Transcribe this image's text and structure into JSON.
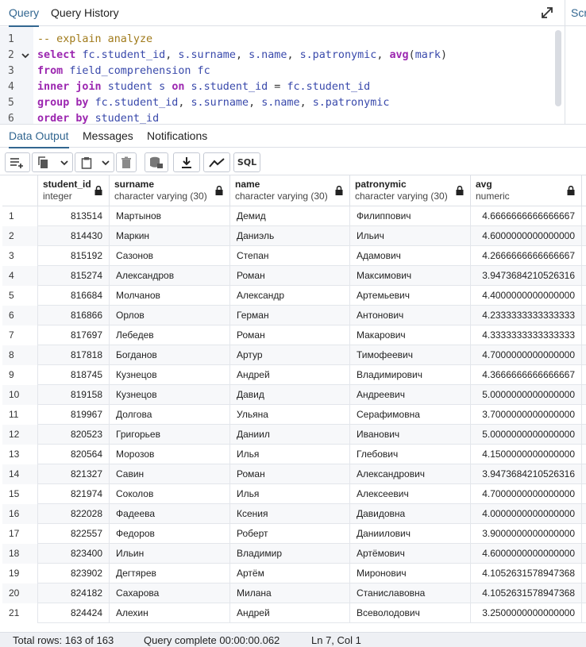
{
  "top_tabs": [
    {
      "label": "Query",
      "active": true
    },
    {
      "label": "Query History",
      "active": false
    }
  ],
  "side_tab_label": "Scr",
  "editor": {
    "lines": [
      {
        "n": "1",
        "tokens": [
          [
            "cm",
            "-- explain analyze"
          ]
        ]
      },
      {
        "n": "2",
        "fold": true,
        "tokens": [
          [
            "kw",
            "select"
          ],
          [
            "op",
            " "
          ],
          [
            "id",
            "fc.student_id"
          ],
          [
            "op",
            ", "
          ],
          [
            "id",
            "s.surname"
          ],
          [
            "op",
            ", "
          ],
          [
            "id",
            "s.name"
          ],
          [
            "op",
            ", "
          ],
          [
            "id",
            "s.patronymic"
          ],
          [
            "op",
            ", "
          ],
          [
            "kw",
            "avg"
          ],
          [
            "op",
            "("
          ],
          [
            "id",
            "mark"
          ],
          [
            "op",
            ")"
          ]
        ]
      },
      {
        "n": "3",
        "tokens": [
          [
            "kw",
            "from"
          ],
          [
            "op",
            " "
          ],
          [
            "id",
            "field_comprehension fc"
          ]
        ]
      },
      {
        "n": "4",
        "tokens": [
          [
            "kw",
            "inner join"
          ],
          [
            "op",
            " "
          ],
          [
            "id",
            "student s"
          ],
          [
            "op",
            " "
          ],
          [
            "kw",
            "on"
          ],
          [
            "op",
            " "
          ],
          [
            "id",
            "s.student_id"
          ],
          [
            "op",
            " = "
          ],
          [
            "id",
            "fc.student_id"
          ]
        ]
      },
      {
        "n": "5",
        "tokens": [
          [
            "kw",
            "group by"
          ],
          [
            "op",
            " "
          ],
          [
            "id",
            "fc.student_id"
          ],
          [
            "op",
            ", "
          ],
          [
            "id",
            "s.surname"
          ],
          [
            "op",
            ", "
          ],
          [
            "id",
            "s.name"
          ],
          [
            "op",
            ", "
          ],
          [
            "id",
            "s.patronymic"
          ]
        ]
      },
      {
        "n": "6",
        "tokens": [
          [
            "kw",
            "order by"
          ],
          [
            "op",
            " "
          ],
          [
            "id",
            "student_id"
          ]
        ]
      }
    ]
  },
  "result_tabs": [
    {
      "label": "Data Output",
      "active": true
    },
    {
      "label": "Messages",
      "active": false
    },
    {
      "label": "Notifications",
      "active": false
    }
  ],
  "toolbar": {
    "sql_label": "SQL"
  },
  "columns": [
    {
      "name": "student_id",
      "type": "integer"
    },
    {
      "name": "surname",
      "type": "character varying (30)"
    },
    {
      "name": "name",
      "type": "character varying (30)"
    },
    {
      "name": "patronymic",
      "type": "character varying (30)"
    },
    {
      "name": "avg",
      "type": "numeric"
    }
  ],
  "rows": [
    [
      "1",
      "813514",
      "Мартынов",
      "Демид",
      "Филиппович",
      "4.6666666666666667"
    ],
    [
      "2",
      "814430",
      "Маркин",
      "Даниэль",
      "Ильич",
      "4.6000000000000000"
    ],
    [
      "3",
      "815192",
      "Сазонов",
      "Степан",
      "Адамович",
      "4.2666666666666667"
    ],
    [
      "4",
      "815274",
      "Александров",
      "Роман",
      "Максимович",
      "3.9473684210526316"
    ],
    [
      "5",
      "816684",
      "Молчанов",
      "Александр",
      "Артемьевич",
      "4.4000000000000000"
    ],
    [
      "6",
      "816866",
      "Орлов",
      "Герман",
      "Антонович",
      "4.2333333333333333"
    ],
    [
      "7",
      "817697",
      "Лебедев",
      "Роман",
      "Макарович",
      "4.3333333333333333"
    ],
    [
      "8",
      "817818",
      "Богданов",
      "Артур",
      "Тимофеевич",
      "4.7000000000000000"
    ],
    [
      "9",
      "818745",
      "Кузнецов",
      "Андрей",
      "Владимирович",
      "4.3666666666666667"
    ],
    [
      "10",
      "819158",
      "Кузнецов",
      "Давид",
      "Андреевич",
      "5.0000000000000000"
    ],
    [
      "11",
      "819967",
      "Долгова",
      "Ульяна",
      "Серафимовна",
      "3.7000000000000000"
    ],
    [
      "12",
      "820523",
      "Григорьев",
      "Даниил",
      "Иванович",
      "5.0000000000000000"
    ],
    [
      "13",
      "820564",
      "Морозов",
      "Илья",
      "Глебович",
      "4.1500000000000000"
    ],
    [
      "14",
      "821327",
      "Савин",
      "Роман",
      "Александрович",
      "3.9473684210526316"
    ],
    [
      "15",
      "821974",
      "Соколов",
      "Илья",
      "Алексеевич",
      "4.7000000000000000"
    ],
    [
      "16",
      "822028",
      "Фадеева",
      "Ксения",
      "Давидовна",
      "4.0000000000000000"
    ],
    [
      "17",
      "822557",
      "Федоров",
      "Роберт",
      "Даниилович",
      "3.9000000000000000"
    ],
    [
      "18",
      "823400",
      "Ильин",
      "Владимир",
      "Артёмович",
      "4.6000000000000000"
    ],
    [
      "19",
      "823902",
      "Дегтярев",
      "Артём",
      "Миронович",
      "4.1052631578947368"
    ],
    [
      "20",
      "824182",
      "Сахарова",
      "Милана",
      "Станиславовна",
      "4.1052631578947368"
    ],
    [
      "21",
      "824424",
      "Алехин",
      "Андрей",
      "Всеволодович",
      "3.2500000000000000"
    ]
  ],
  "status": {
    "total_rows": "Total rows: 163 of 163",
    "query_time": "Query complete 00:00:00.062",
    "cursor": "Ln 7, Col 1"
  }
}
